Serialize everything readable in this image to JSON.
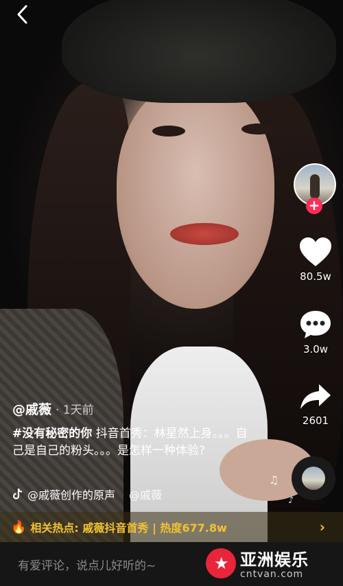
{
  "actions": {
    "likes": "80.5w",
    "comments": "3.0w",
    "shares": "2601"
  },
  "post": {
    "author": "@戚薇",
    "time": "· 1天前",
    "hashtag": "#没有秘密的你",
    "text": " 抖音首秀：林星然上身。。。自己是自己的粉头。。。是怎样一种体验?",
    "music": "@戚薇创作的原声",
    "music_mention": "@戚薇"
  },
  "hot": {
    "text": "相关热点: 戚薇抖音首秀 | 热度677.8w"
  },
  "comment": {
    "placeholder": "有爱评论，说点儿好听的~"
  },
  "watermark": {
    "cn": "亚洲娱乐",
    "en": "cntvan.com"
  },
  "colors": {
    "accent_red": "#fe2c55",
    "hot_yellow": "#f2c230"
  }
}
